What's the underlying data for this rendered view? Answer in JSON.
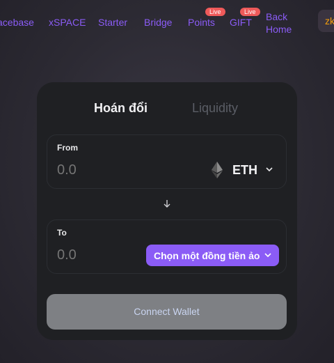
{
  "nav": {
    "items": [
      {
        "label": "acebase"
      },
      {
        "label": "xSPACE"
      },
      {
        "label": "Starter"
      },
      {
        "label": "Bridge"
      },
      {
        "label": "Points",
        "badge": "Live"
      },
      {
        "label": "GIFT",
        "badge": "Live"
      },
      {
        "label": "Back Home"
      }
    ],
    "truncated_button": "zk",
    "accent_color": "#8b5cf6",
    "badge_color": "#ef5a5a"
  },
  "swap": {
    "tabs": [
      {
        "label": "Hoán đổi",
        "active": true
      },
      {
        "label": "Liquidity",
        "active": false
      }
    ],
    "from": {
      "label": "From",
      "amount": "0.0",
      "token": "ETH",
      "token_icon": "eth-icon",
      "dropdown_icon": "chevron-down-icon"
    },
    "swap_icon": "arrow-down-icon",
    "to": {
      "label": "To",
      "amount": "0.0",
      "select_label": "Chọn một đồng tiền ảo",
      "dropdown_icon": "chevron-down-icon"
    },
    "connect_label": "Connect Wallet"
  }
}
